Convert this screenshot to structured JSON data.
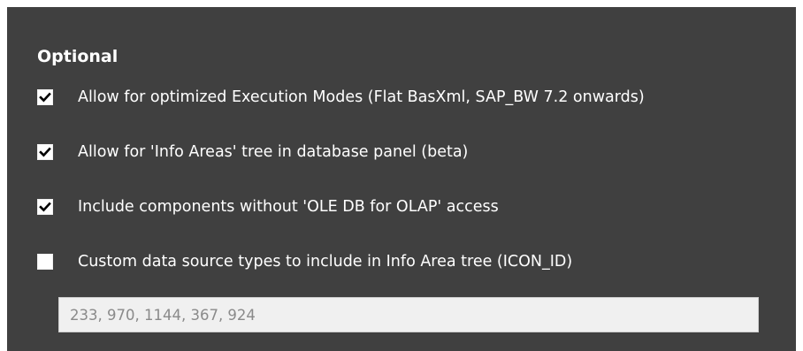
{
  "section": {
    "title": "Optional"
  },
  "options": [
    {
      "label": "Allow for optimized Execution Modes (Flat BasXml, SAP_BW 7.2 onwards)",
      "checked": true
    },
    {
      "label": "Allow for 'Info Areas' tree in database panel (beta)",
      "checked": true
    },
    {
      "label": "Include components without 'OLE DB for OLAP' access",
      "checked": true
    },
    {
      "label": "Custom data source types to include in Info Area tree (ICON_ID)",
      "checked": false
    }
  ],
  "custom_types_field": {
    "value": "233, 970, 1144, 367, 924"
  },
  "colors": {
    "panel_background": "#404040",
    "text": "#ffffff",
    "checkbox_fill": "#ffffff",
    "check_mark": "#000000",
    "input_background": "#f0f0f0",
    "input_text": "#8a8a8a"
  }
}
